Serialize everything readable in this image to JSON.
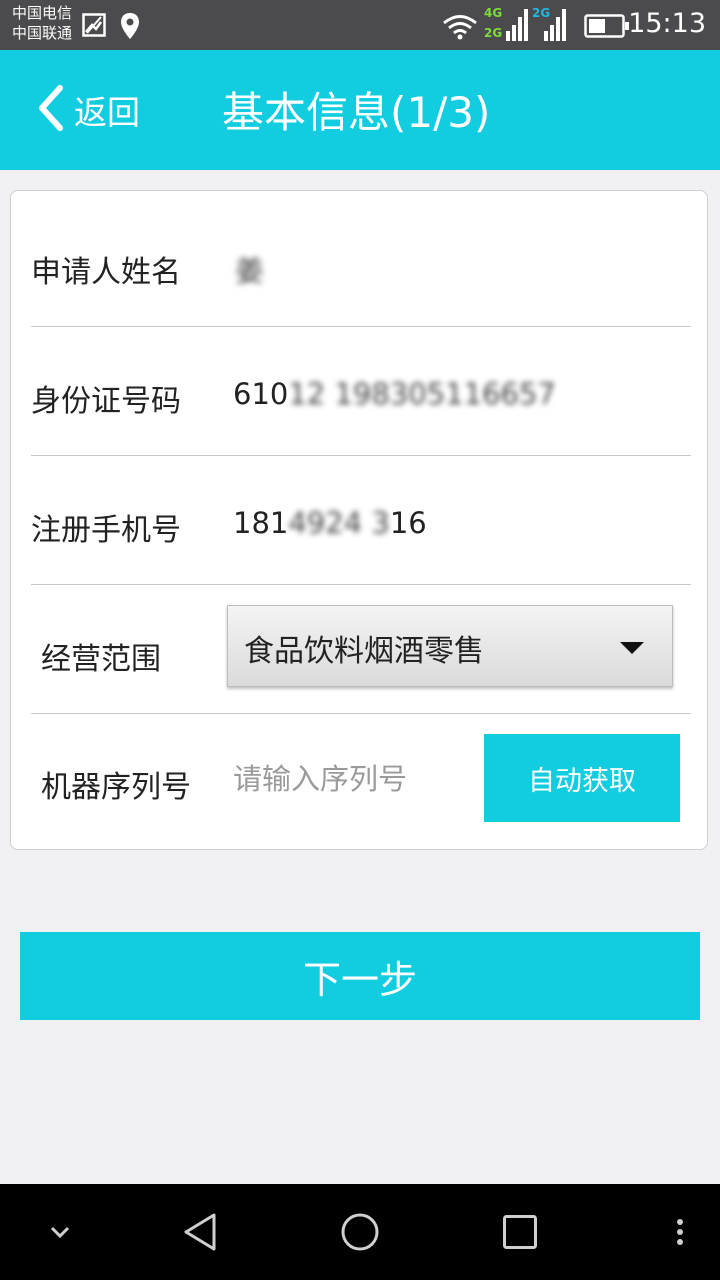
{
  "status_bar": {
    "carrier_1": "中国电信",
    "carrier_2": "中国联通",
    "network_1": "4G",
    "network_2": "2G",
    "network_3": "2G",
    "time": "15:13",
    "icons": [
      "image-notification-icon",
      "location-icon",
      "wifi-icon",
      "signal-4g-icon",
      "signal-2g-icon",
      "battery-icon"
    ]
  },
  "header": {
    "back_label": "返回",
    "title": "基本信息(1/3)"
  },
  "form": {
    "name_label": "申请人姓名",
    "name_value": "姜 ",
    "id_label": "身份证号码",
    "id_prefix": "610",
    "id_rest": "12 198305116657",
    "phone_label": "注册手机号",
    "phone_prefix": "181",
    "phone_mid": "4924 3",
    "phone_suffix": "16",
    "scope_label": "经营范围",
    "scope_value": "食品饮料烟酒零售",
    "serial_label": "机器序列号",
    "serial_placeholder": "请输入序列号",
    "serial_value": "",
    "auto_button": "自动获取"
  },
  "next_button": "下一步",
  "colors": {
    "accent": "#12cde0",
    "status_bar": "#4b4b4d",
    "background": "#f1f1f3",
    "nav_bar": "#000000"
  },
  "nav_bar": {
    "icons": [
      "collapse-chevron-icon",
      "back-triangle-icon",
      "home-circle-icon",
      "recents-square-icon",
      "more-dots-icon"
    ]
  }
}
